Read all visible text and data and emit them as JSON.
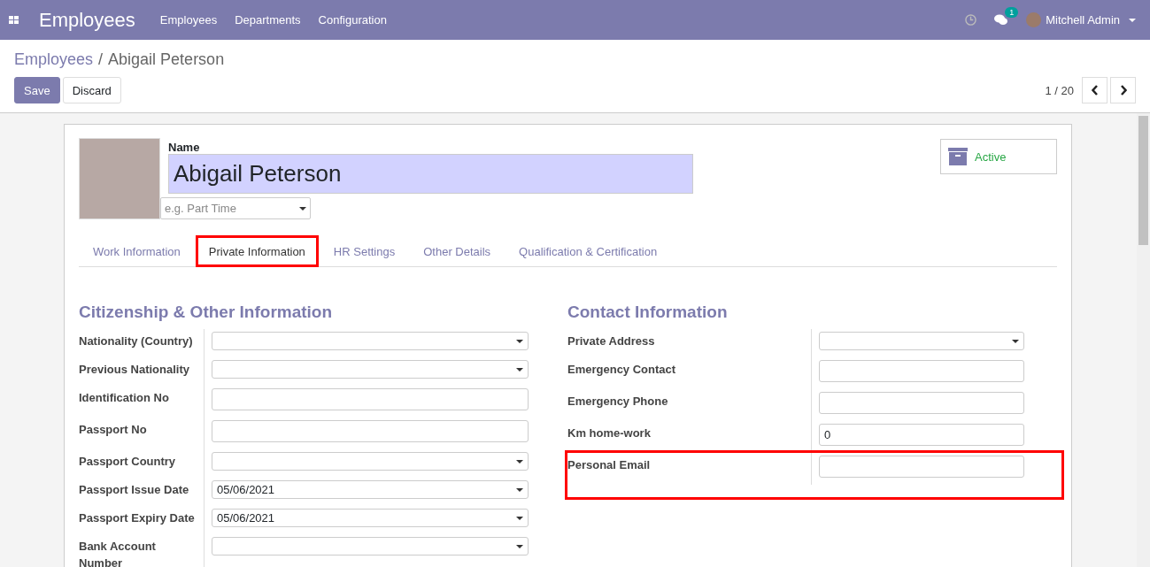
{
  "topbar": {
    "app_title": "Employees",
    "menu": [
      "Employees",
      "Departments",
      "Configuration"
    ],
    "messages_badge": "1",
    "user": "Mitchell Admin"
  },
  "breadcrumb": {
    "parent": "Employees",
    "separator": "/",
    "current": "Abigail Peterson"
  },
  "buttons": {
    "save": "Save",
    "discard": "Discard"
  },
  "pager": {
    "text": "1 / 20"
  },
  "form": {
    "status": "Active",
    "name_label": "Name",
    "name_value": "Abigail Peterson",
    "job_placeholder": "e.g. Part Time",
    "tabs": [
      {
        "label": "Work Information",
        "selected": false,
        "highlighted": false
      },
      {
        "label": "Private Information",
        "selected": true,
        "highlighted": true
      },
      {
        "label": "HR Settings",
        "selected": false,
        "highlighted": false
      },
      {
        "label": "Other Details",
        "selected": false,
        "highlighted": false
      },
      {
        "label": "Qualification & Certification",
        "selected": false,
        "highlighted": false
      }
    ],
    "left": {
      "title": "Citizenship & Other Information",
      "fields": [
        {
          "label": "Nationality (Country)",
          "kind": "select",
          "highlighted": false
        },
        {
          "label": "Previous Nationality",
          "kind": "select",
          "highlighted": false
        },
        {
          "label": "Identification No",
          "kind": "input",
          "highlighted": false
        },
        {
          "label": "Passport No",
          "kind": "input",
          "highlighted": false
        },
        {
          "label": "Passport Country",
          "kind": "select",
          "highlighted": false
        },
        {
          "label": "Passport Issue Date",
          "kind": "select",
          "value": "05/06/2021",
          "highlighted": false
        },
        {
          "label": "Passport Expiry Date",
          "kind": "select",
          "value": "05/06/2021",
          "highlighted": false
        },
        {
          "label": "Bank Account Number",
          "kind": "select",
          "highlighted": false
        }
      ]
    },
    "right": {
      "title": "Contact Information",
      "fields": [
        {
          "label": "Private Address",
          "kind": "select",
          "highlighted": false
        },
        {
          "label": "Emergency Contact",
          "kind": "input",
          "highlighted": false
        },
        {
          "label": "Emergency Phone",
          "kind": "input",
          "highlighted": false
        },
        {
          "label": "Km home-work",
          "kind": "input",
          "value": "0",
          "highlighted": false
        },
        {
          "label": "Personal Email",
          "kind": "input",
          "highlighted": true
        }
      ]
    }
  }
}
